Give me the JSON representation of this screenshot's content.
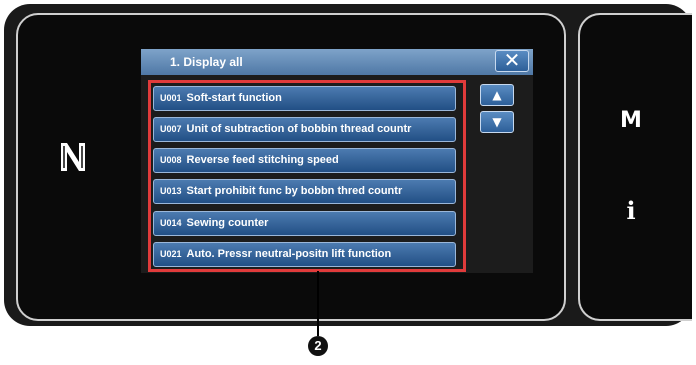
{
  "panel": {
    "title": "1.  Display all",
    "close_label": "✕",
    "scroll_up_label": "▲",
    "scroll_down_label": "▼"
  },
  "items": [
    {
      "code": "U001",
      "label": "Soft-start function"
    },
    {
      "code": "U007",
      "label": "Unit of subtraction of bobbin thread countr"
    },
    {
      "code": "U008",
      "label": "Reverse feed stitching speed"
    },
    {
      "code": "U013",
      "label": "Start prohibit func by bobbn thred countr"
    },
    {
      "code": "U014",
      "label": "Sewing counter"
    },
    {
      "code": "U021",
      "label": "Auto. Pressr neutral-positn lift function"
    }
  ],
  "side": {
    "m_label": "M",
    "info_label": "i"
  },
  "callout_label": "2",
  "colors": {
    "highlight": "#e03b3b",
    "button": "#2d5f99",
    "title_bar": "#4f78a6"
  },
  "icons": [
    "nfc-icon",
    "close-icon",
    "scroll-up-icon",
    "scroll-down-icon",
    "info-icon"
  ]
}
